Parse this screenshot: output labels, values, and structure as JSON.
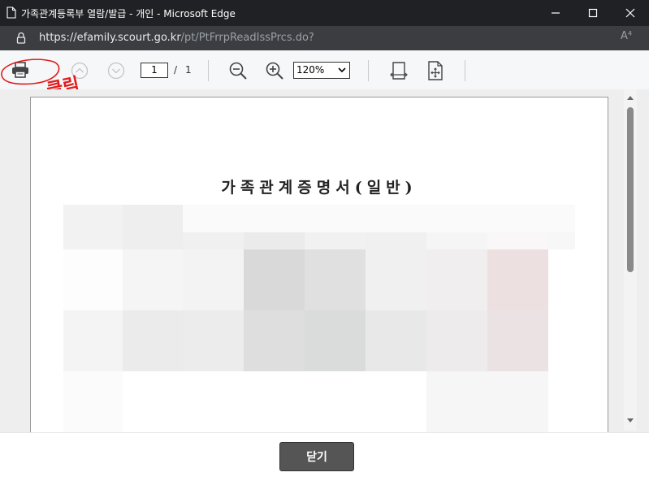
{
  "window": {
    "title": "가족관계등록부 열람/발급 - 개인 - Microsoft Edge",
    "icons": [
      "document-icon",
      "minimize-icon",
      "maximize-icon",
      "close-icon"
    ]
  },
  "address_bar": {
    "url_host": "https://efamily.scourt.go.kr",
    "url_path": "/pt/PtFrrpReadIssPrcs.do?",
    "icons": [
      "lock-icon",
      "read-aloud-icon"
    ],
    "read_aloud_glyph": "A⁴"
  },
  "toolbar": {
    "current_page": "1",
    "page_separator": "/",
    "total_pages": "1",
    "zoom_level": "120%",
    "icons": [
      "print-icon",
      "previous-page-icon",
      "next-page-icon",
      "zoom-out-icon",
      "zoom-in-icon",
      "fit-width-icon",
      "fit-page-icon"
    ]
  },
  "annotation": {
    "text": "클릭",
    "color": "#e21b1b"
  },
  "document": {
    "title": "가족관계증명서(일반)",
    "content_state": "pixelated"
  },
  "footer": {
    "close_label": "닫기"
  },
  "colors": {
    "titlebar_bg": "#202124",
    "addressbar_bg": "#3b3d40",
    "toolbar_bg": "#f6f7f9",
    "viewer_bg": "#eeeeee",
    "close_button_bg": "#555555"
  }
}
